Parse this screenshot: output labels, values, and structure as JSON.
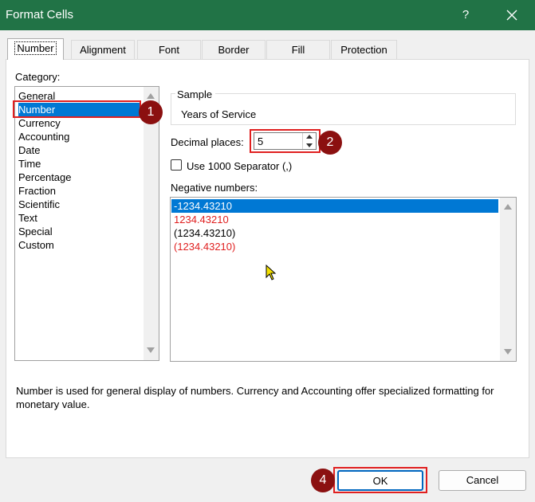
{
  "window": {
    "title": "Format Cells",
    "help_label": "?"
  },
  "tabs": [
    {
      "label": "Number",
      "active": true
    },
    {
      "label": "Alignment"
    },
    {
      "label": "Font"
    },
    {
      "label": "Border"
    },
    {
      "label": "Fill"
    },
    {
      "label": "Protection"
    }
  ],
  "category": {
    "label": "Category:",
    "items": [
      "General",
      "Number",
      "Currency",
      "Accounting",
      "Date",
      "Time",
      "Percentage",
      "Fraction",
      "Scientific",
      "Text",
      "Special",
      "Custom"
    ],
    "selected": "Number"
  },
  "sample": {
    "label": "Sample",
    "value": "Years of Service"
  },
  "decimal_places": {
    "label": "Decimal places:",
    "value": "5"
  },
  "separator": {
    "label": "Use 1000 Separator (,)",
    "checked": false
  },
  "negative_numbers": {
    "label": "Negative numbers:",
    "items": [
      {
        "text": "-1234.43210",
        "color": "#000000",
        "selected": true
      },
      {
        "text": "1234.43210",
        "color": "#e02020"
      },
      {
        "text": "(1234.43210)",
        "color": "#000000"
      },
      {
        "text": "(1234.43210)",
        "color": "#e02020"
      }
    ]
  },
  "description": "Number is used for general display of numbers.  Currency and Accounting offer specialized formatting for monetary value.",
  "buttons": {
    "ok": "OK",
    "cancel": "Cancel"
  },
  "callouts": [
    "1",
    "2",
    "4"
  ],
  "colors": {
    "titlebar": "#217346",
    "selection": "#0078d4",
    "callout": "#8b1010",
    "highlight": "#e02020"
  }
}
